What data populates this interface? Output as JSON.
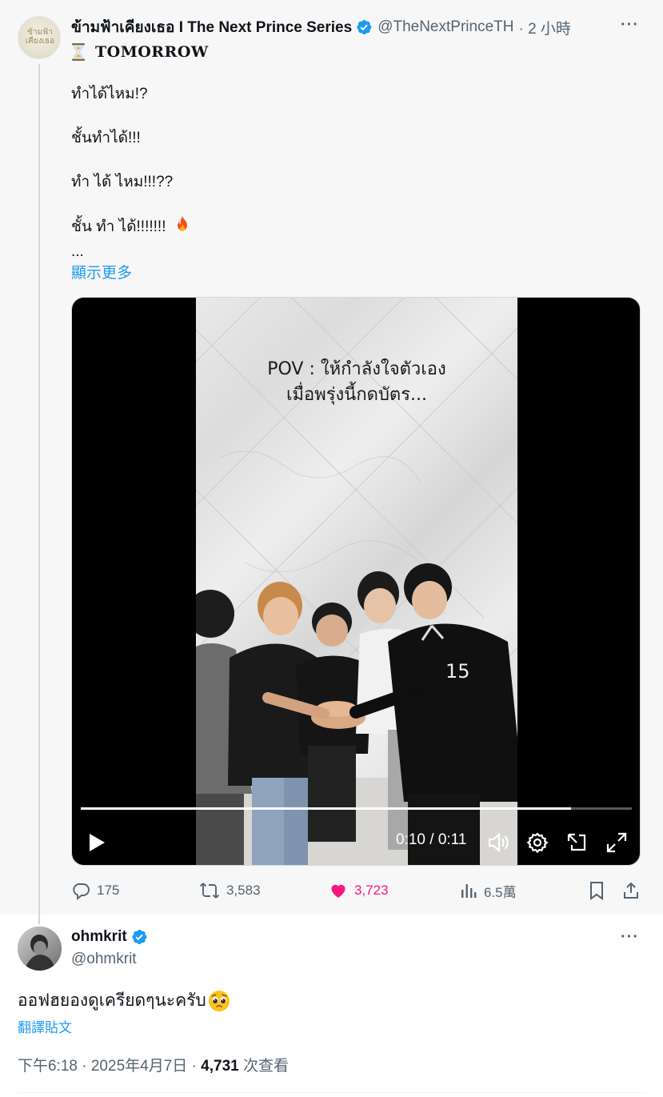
{
  "parent_tweet": {
    "display_name": "ข้ามฟ้าเคียงเธอ I The Next Prince Series",
    "handle": "@TheNextPrinceTH",
    "time": "· 2 小時",
    "avatar_text": "ข้ามฟ้า เคียงเธอ",
    "headline": "TOMORROW",
    "lines": [
      "ทำได้ไหม!?",
      "ชั้นทำได้!!!",
      "ทำ ได้ ไหม!!!??",
      "ชั้น ทำ ได้!!!!!!! "
    ],
    "ellipsis": "...",
    "show_more": "顯示更多",
    "video": {
      "overlay_line1": "POV : ให้กำลังใจตัวเอง",
      "overlay_line2": "เมื่อพรุ่งนี้กดบัตร...",
      "time": "0:10 / 0:11",
      "progress": 0.89,
      "jersey_number": "15"
    },
    "actions": {
      "replies": "175",
      "retweets": "3,583",
      "likes": "3,723",
      "views": "6.5萬"
    }
  },
  "reply_tweet": {
    "display_name": "ohmkrit",
    "handle": "@ohmkrit",
    "text": "ออฟฮยองดูเครียดๆนะครับ",
    "translate": "翻譯貼文",
    "timestamp": "下午6:18 · 2025年4月7日 · ",
    "view_count": "4,731",
    "view_label": " 次查看"
  },
  "colors": {
    "accent": "#1d9bf0",
    "like": "#f91880",
    "muted": "#536471",
    "verified": "#1d9bf0"
  },
  "icons": [
    "verified-badge-icon",
    "hourglass-icon",
    "fire-icon",
    "more-icon",
    "play-icon",
    "volume-icon",
    "settings-icon",
    "pip-icon",
    "fullscreen-icon",
    "reply-icon",
    "retweet-icon",
    "heart-icon",
    "analytics-icon",
    "bookmark-icon",
    "share-icon",
    "pleading-face-icon"
  ]
}
